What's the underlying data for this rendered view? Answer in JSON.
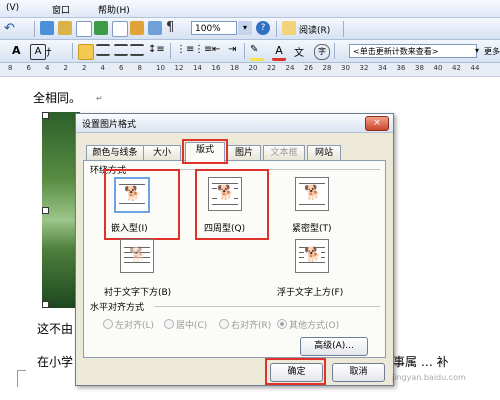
{
  "menu": {
    "view_partial": "(V)",
    "window": "窗口",
    "help": "帮助(H)"
  },
  "toolbar": {
    "zoom": "100%",
    "read": "阅读(R)",
    "style_box": "<单击更新计数来查看>",
    "more": "更多"
  },
  "ruler": {
    "marks": [
      "8",
      "6",
      "4",
      "2",
      "2",
      "4",
      "6",
      "8",
      "10",
      "12",
      "14",
      "16",
      "18",
      "20",
      "22",
      "24",
      "26",
      "28",
      "30",
      "32",
      "34",
      "36",
      "38",
      "40",
      "42",
      "44"
    ]
  },
  "doc": {
    "line1": "全相同。",
    "line2": "这不由",
    "line3": "在小学",
    "line3_right": "事属 … 补"
  },
  "dialog": {
    "title": "设置图片格式",
    "close": "×",
    "tabs": [
      "颜色与线条",
      "大小",
      "版式",
      "图片",
      "文本框",
      "网站"
    ],
    "wrap_section": "环绕方式",
    "wrap": [
      "嵌入型(I)",
      "四周型(Q)",
      "紧密型(T)",
      "衬于文字下方(B)",
      "浮于文字上方(F)"
    ],
    "align_section": "水平对齐方式",
    "align": [
      "左对齐(L)",
      "居中(C)",
      "右对齐(R)",
      "其他方式(O)"
    ],
    "advanced": "高级(A)...",
    "ok": "确定",
    "cancel": "取消"
  },
  "watermark": "jingyan.baidu.com"
}
